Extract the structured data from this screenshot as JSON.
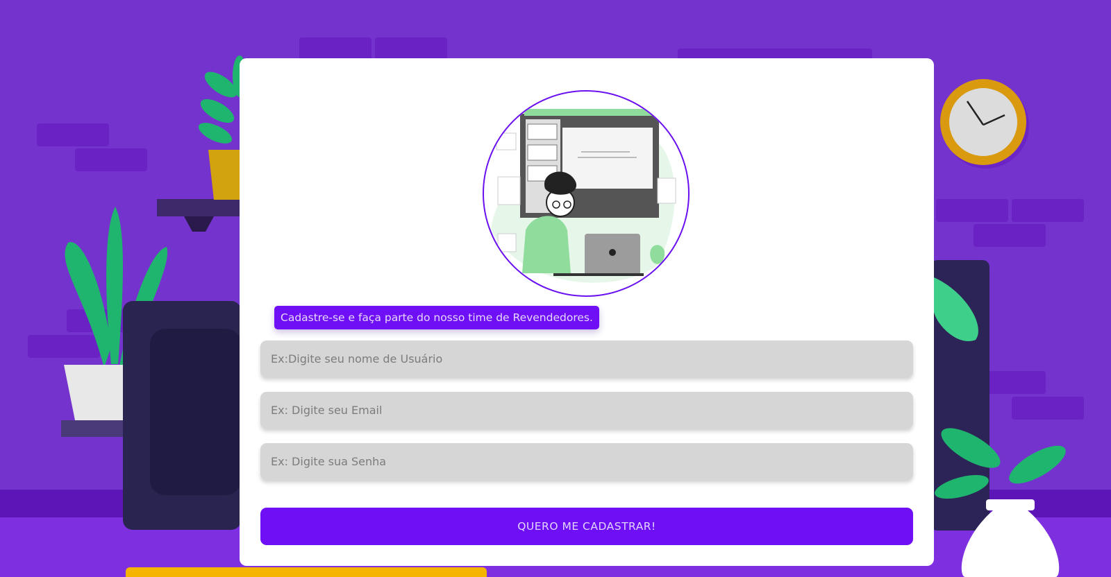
{
  "colors": {
    "background": "#7433cc",
    "accent": "#6e0ff5",
    "card": "#ffffff",
    "input": "#d6d6d6"
  },
  "hero": {
    "icon": "person-at-laptop-illustration-icon"
  },
  "form": {
    "tagline": "Cadastre-se e faça parte do nosso time de Revendedores.",
    "username_placeholder": "Ex:Digite seu nome de Usuário",
    "email_placeholder": "Ex: Digite seu Email",
    "password_placeholder": "Ex: Digite sua Senha",
    "submit_label": "QUERO ME CADASTRAR!"
  }
}
